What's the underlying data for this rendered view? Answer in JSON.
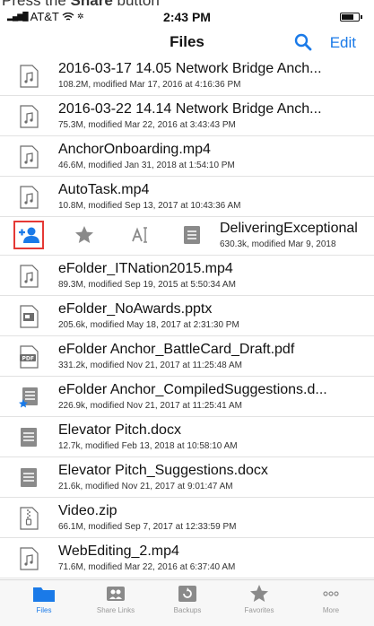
{
  "caption": {
    "prefix": "Press the ",
    "bold": "Share",
    "suffix": " button"
  },
  "status": {
    "carrier": "AT&T",
    "time": "2:43 PM"
  },
  "nav": {
    "title": "Files",
    "edit": "Edit"
  },
  "files": [
    {
      "name": "2016-03-17 14.05 Network Bridge Anch...",
      "meta": "108.2M, modified Mar 17, 2016 at 4:16:36 PM",
      "icon": "audio-file-icon"
    },
    {
      "name": "2016-03-22 14.14 Network Bridge Anch...",
      "meta": "75.3M, modified Mar 22, 2016 at 3:43:43 PM",
      "icon": "audio-file-icon"
    },
    {
      "name": "AnchorOnboarding.mp4",
      "meta": "46.6M, modified Jan 31, 2018 at 1:54:10 PM",
      "icon": "audio-file-icon"
    },
    {
      "name": "AutoTask.mp4",
      "meta": "10.8M, modified Sep 13, 2017 at 10:43:36 AM",
      "icon": "audio-file-icon"
    }
  ],
  "swiped": {
    "name": "DeliveringExceptional",
    "meta": "630.3k, modified Mar 9, 2018"
  },
  "files2": [
    {
      "name": "eFolder_ITNation2015.mp4",
      "meta": "89.3M, modified Sep 19, 2015 at 5:50:34 AM",
      "icon": "audio-file-icon"
    },
    {
      "name": "eFolder_NoAwards.pptx",
      "meta": "205.6k, modified May 18, 2017 at 2:31:30 PM",
      "icon": "presentation-file-icon"
    },
    {
      "name": "eFolder Anchor_BattleCard_Draft.pdf",
      "meta": "331.2k, modified Nov 21, 2017 at 11:25:48 AM",
      "icon": "pdf-file-icon"
    },
    {
      "name": "eFolder Anchor_CompiledSuggestions.d...",
      "meta": "226.9k, modified Nov 21, 2017 at 11:25:41 AM",
      "icon": "favorite-doc-file-icon"
    },
    {
      "name": "Elevator Pitch.docx",
      "meta": "12.7k, modified Feb 13, 2018 at 10:58:10 AM",
      "icon": "doc-file-icon"
    },
    {
      "name": "Elevator Pitch_Suggestions.docx",
      "meta": "21.6k, modified Nov 21, 2017 at 9:01:47 AM",
      "icon": "doc-file-icon"
    },
    {
      "name": "Video.zip",
      "meta": "66.1M, modified Sep 7, 2017 at 12:33:59 PM",
      "icon": "zip-file-icon"
    },
    {
      "name": "WebEditing_2.mp4",
      "meta": "71.6M, modified Mar 22, 2016 at 6:37:40 AM",
      "icon": "audio-file-icon"
    }
  ],
  "tabs": [
    {
      "label": "Files",
      "icon": "folder-icon",
      "active": true
    },
    {
      "label": "Share Links",
      "icon": "share-links-icon",
      "active": false
    },
    {
      "label": "Backups",
      "icon": "backups-icon",
      "active": false
    },
    {
      "label": "Favorites",
      "icon": "star-icon",
      "active": false
    },
    {
      "label": "More",
      "icon": "more-icon",
      "active": false
    }
  ],
  "colors": {
    "accent": "#1a7ae8",
    "highlight": "#e53935",
    "icon_gray": "#8a8a8a"
  }
}
